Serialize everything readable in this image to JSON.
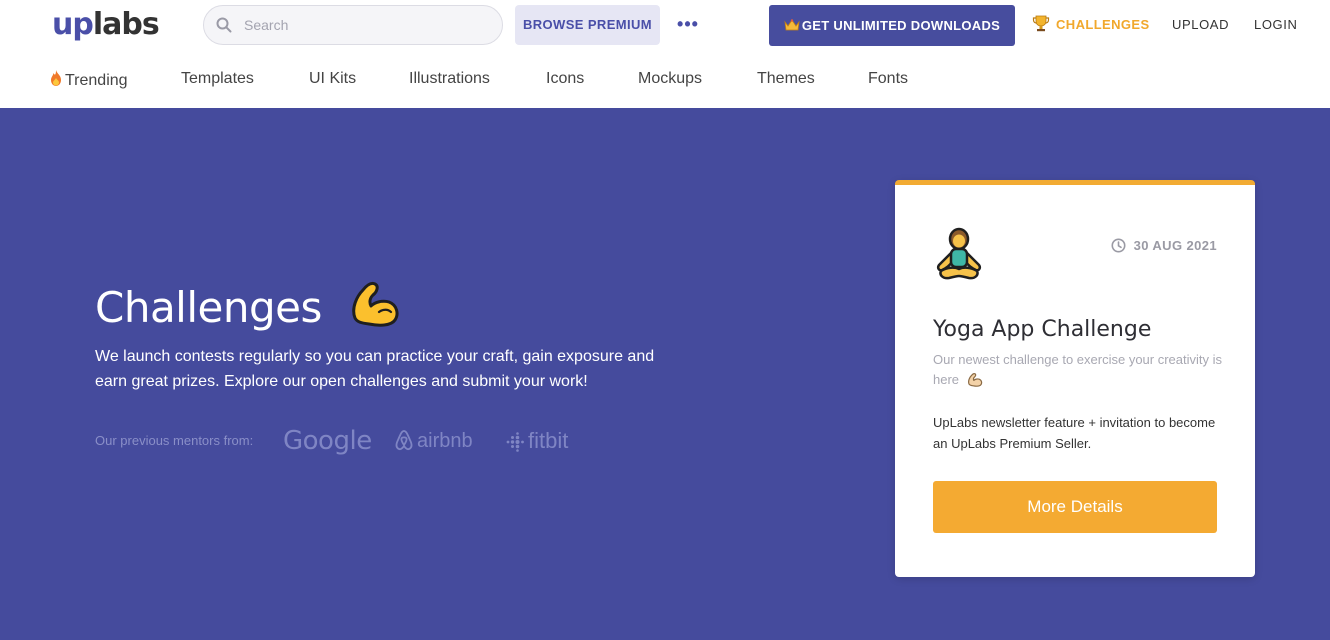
{
  "header": {
    "logo_up": "up",
    "logo_labs": "labs",
    "search_placeholder": "Search",
    "browse_premium": "BROWSE PREMIUM",
    "more_label": "•••",
    "unlimited_label": "GET UNLIMITED DOWNLOADS",
    "challenges_label": "CHALLENGES",
    "upload_label": "UPLOAD",
    "login_label": "LOGIN"
  },
  "subnav": {
    "items": [
      "Trending",
      "Templates",
      "UI Kits",
      "Illustrations",
      "Icons",
      "Mockups",
      "Themes",
      "Fonts"
    ]
  },
  "hero": {
    "title": "Challenges",
    "description": "We launch contests regularly so you can practice your craft, gain exposure and earn great prizes. Explore our open challenges and submit your work!",
    "mentors_label": "Our previous mentors from:",
    "mentors": [
      "Google",
      "airbnb",
      "fitbit"
    ]
  },
  "card": {
    "date": "30 AUG 2021",
    "title": "Yoga App Challenge",
    "subtitle": "Our newest challenge to exercise your creativity is here",
    "prize": "UpLabs newsletter feature + invitation to become an UpLabs Premium Seller.",
    "button": "More Details"
  },
  "colors": {
    "brand": "#4a4fa8",
    "hero_bg": "#454b9d",
    "accent_orange": "#f4aa32",
    "challenges_gold": "#f1a82c"
  },
  "icons": [
    "search-icon",
    "more-icon",
    "crown-icon",
    "trophy-icon",
    "fire-icon",
    "flexed-biceps-icon",
    "airbnb-icon",
    "fitbit-icon",
    "yoga-person-icon",
    "clock-icon"
  ]
}
